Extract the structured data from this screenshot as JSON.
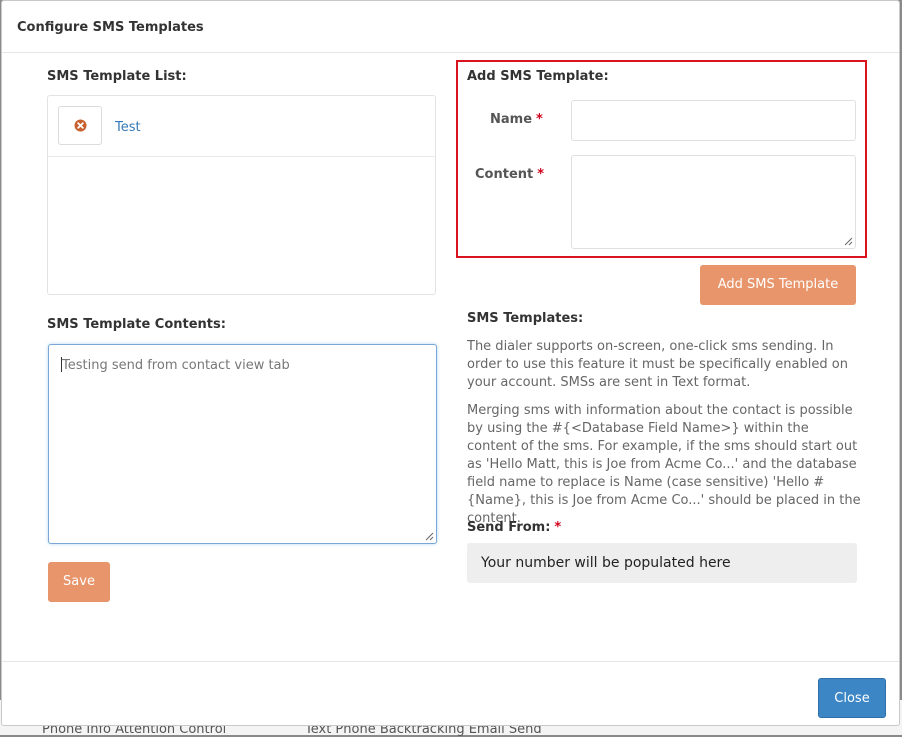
{
  "underlay": {
    "text_left": "Phone Info  Attention Control",
    "text_right": "Text Phone  Backtracking  Email  Send"
  },
  "modal": {
    "title": "Configure SMS Templates"
  },
  "template_list": {
    "label": "SMS Template List:",
    "items": [
      {
        "name": "Test",
        "icon": "delete-circle-icon"
      }
    ]
  },
  "template_contents": {
    "label": "SMS Template Contents:",
    "value": "Testing send from contact view tab"
  },
  "save_button": "Save",
  "add_template": {
    "title": "Add SMS Template:",
    "name_label": "Name",
    "content_label": "Content",
    "required_marker": "*",
    "name_value": "",
    "content_value": "",
    "button": "Add SMS Template"
  },
  "help": {
    "title": "SMS Templates:",
    "paragraph1": "The dialer supports on-screen, one-click sms sending. In order to use this feature it must be specifically enabled on your account. SMSs are sent in Text format.",
    "paragraph2": "Merging sms with information about the contact is possible by using the #{<Database Field Name>} within the content of the sms. For example, if the sms should start out as 'Hello Matt, this is Joe from Acme Co...' and the database field name to replace is Name (case sensitive) 'Hello #{Name}, this is Joe from Acme Co...' should be placed in the content."
  },
  "send_from": {
    "label": "Send From:",
    "required_marker": "*",
    "value": "Your number will be populated here"
  },
  "close_button": "Close",
  "colors": {
    "primary_button": "#3d86c6",
    "accent_button": "#e8956b",
    "highlight_border": "#d9141f",
    "required": "#d0021b",
    "link": "#337ab7"
  }
}
